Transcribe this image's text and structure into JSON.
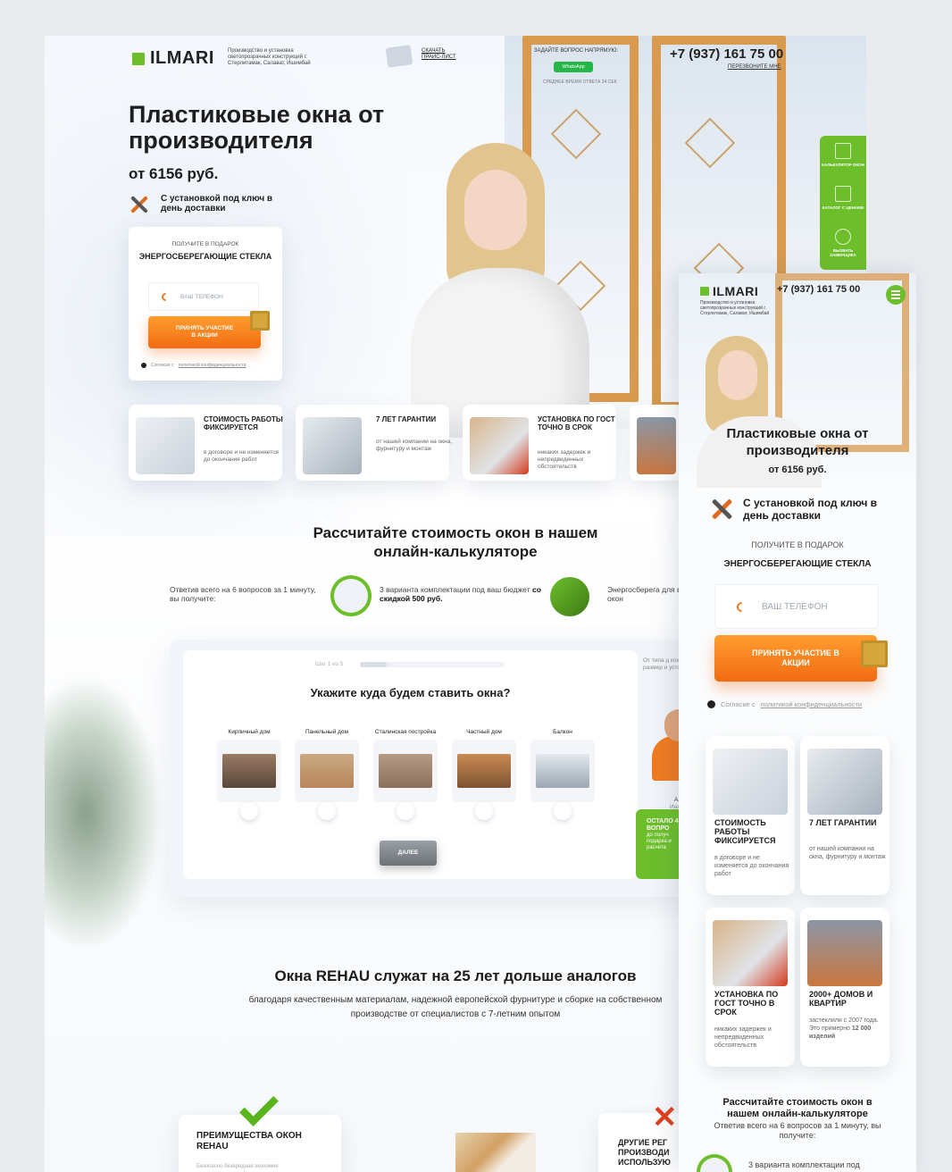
{
  "colors": {
    "accent_green": "#6cbf2a",
    "cta_orange": "#f26b12",
    "dark_text": "#1e1e1e",
    "whatsapp_green": "#25b64a"
  },
  "header": {
    "logo": "ILMARI",
    "tagline": "Производство и установка светопрозрачных конструкций г. Стерлитамак, Салават, Ишимбай",
    "price_link": "СКАЧАТЬ ПРАЙС-ЛИСТ",
    "ask": "ЗАДАЙТЕ ВОПРОС НАПРЯМУЮ:",
    "whatsapp": "WhatsApp",
    "ask_note": "СРЕДНЕЕ ВРЕМЯ ОТВЕТА 24 СЕК.",
    "phone": "+7 (937) 161 75 00",
    "callback": "ПЕРЕЗВОНИТЕ МНЕ"
  },
  "hero": {
    "title": "Пластиковые окна от производителя",
    "price": "от 6156 руб.",
    "install": "С установкой под ключ в день доставки"
  },
  "form": {
    "gift_pre": "ПОЛУЧИТЕ В ПОДАРОК",
    "gift_title": "ЭНЕРГОСБЕРЕГАЮЩИЕ СТЕКЛА",
    "phone_placeholder": "ВАШ ТЕЛЕФОН",
    "cta": "ПРИНЯТЬ УЧАСТИЕ В АКЦИИ",
    "consent_pre": "Согласие с",
    "consent_link": "политикой конфиденциальности"
  },
  "side_panel": [
    "КАЛЬКУЛЯТОР ОКОН",
    "КАТАЛОГ С ЦЕНАМИ",
    "ВЫЗВАТЬ ЗАМЕРЩИКА"
  ],
  "features": [
    {
      "title": "СТОИМОСТЬ РАБОТЫ ФИКСИРУЕТСЯ",
      "desc": "в договоре и не изменяется до окончания работ"
    },
    {
      "title": "7 ЛЕТ ГАРАНТИИ",
      "desc": "от нашей компании на окна, фурнитуру и монтаж"
    },
    {
      "title": "УСТАНОВКА ПО ГОСТ ТОЧНО В СРОК",
      "desc": "никаких задержек и непредвиденных обстоятельств"
    },
    {
      "title": "2000+ ДОМОВ И КВАРТИР",
      "desc": "застеклили с 2007 года. Это примерно",
      "desc_bold": "12 000 изделий"
    }
  ],
  "calc": {
    "title": "Рассчитайте стоимость окон в нашем онлайн-калькуляторе",
    "t1": "Ответив всего на 6 вопросов за 1 минуту, вы получите:",
    "t2": "3 варианта комплектации под ваш бюджет",
    "t2_bold": "со скидкой 500 руб.",
    "t3": "Энергосберега для ваших окон"
  },
  "quiz": {
    "step": "Шаг 1 из 5",
    "question": "Укажите куда будем ставить окна?",
    "options": [
      "Кирпичный дом",
      "Панельный дом",
      "Сталинская постройка",
      "Частный дом",
      "Балкон"
    ],
    "next": "ДАЛЕЕ",
    "side_text": "От типа д комплект размер и установк",
    "engineer_name": "Алек",
    "engineer_role": "Инжене",
    "left_title": "ОСТАЛО 4 ВОПРО",
    "left_sub": "до получ подарка и расчета"
  },
  "rehau": {
    "title": "Окна REHAU служат на 25 лет дольше аналогов",
    "subtitle": "благодаря качественным материалам, надежной европейской фурнитуре и сборке на собственном производстве от специалистов с 7-летним опытом",
    "adv_title": "ПРЕИМУЩЕСТВА ОКОН REHAU",
    "adv_desc": "Безопасно безвредная экономия",
    "other_title": "ДРУГИЕ РЕГ ПРОИЗВОДИ ИСПОЛЬЗУЮ"
  },
  "mobile": {
    "logo": "ILMARI",
    "tagline": "Производство и установка светопрозрачных конструкций г. Стерлитамак, Салават, Ишимбай",
    "phone": "+7 (937) 161 75 00",
    "title": "Пластиковые окна от производителя",
    "price": "от 6156 руб.",
    "install": "С установкой под ключ в день доставки",
    "gift_pre": "ПОЛУЧИТЕ В ПОДАРОК",
    "gift_title": "ЭНЕРГОСБЕРЕГАЮЩИЕ СТЕКЛА",
    "phone_placeholder": "ВАШ ТЕЛЕФОН",
    "cta": "ПРИНЯТЬ УЧАСТИЕ В АКЦИИ",
    "consent_pre": "Согласие с",
    "consent_link": "политикой конфиденциальности",
    "calc_title": "Рассчитайте стоимость окон в нашем онлайн-калькуляторе",
    "calc_sub": "Ответив всего на 6 вопросов за 1 минуту, вы получите:",
    "calc_t2": "3 варианта комплектации под"
  }
}
